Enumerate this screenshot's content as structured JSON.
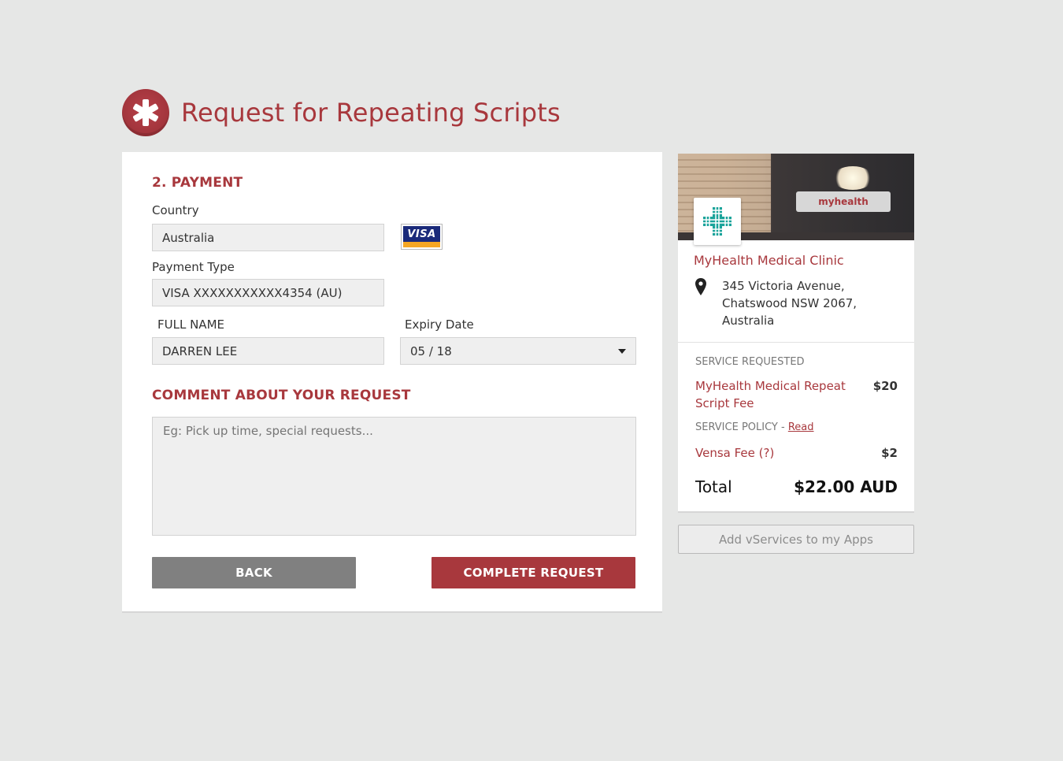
{
  "header": {
    "title": "Request for Repeating Scripts",
    "logo_icon": "asterisk-icon"
  },
  "payment": {
    "section_title": "2. PAYMENT",
    "country_label": "Country",
    "country_value": "Australia",
    "card_brand": "VISA",
    "payment_type_label": "Payment Type",
    "payment_type_value": "VISA XXXXXXXXXXX4354 (AU)",
    "full_name_label": "FULL NAME",
    "full_name_value": "DARREN LEE",
    "expiry_label": "Expiry Date",
    "expiry_value": "05 / 18"
  },
  "comment": {
    "section_title": "COMMENT ABOUT YOUR REQUEST",
    "placeholder": "Eg: Pick up time, special requests..."
  },
  "buttons": {
    "back": "BACK",
    "complete": "COMPLETE REQUEST",
    "add_vservices": "Add vServices to my Apps"
  },
  "clinic": {
    "name": "MyHealth Medical Clinic",
    "sign_text": "myhealth",
    "address_line1": "345 Victoria Avenue,",
    "address_line2": "Chatswood NSW 2067,",
    "address_line3": "Australia"
  },
  "summary": {
    "service_requested_label": "SERVICE REQUESTED",
    "service_name_line1": "MyHealth Medical Repeat",
    "service_name_line2": "Script Fee",
    "service_price": "$20",
    "policy_label": "SERVICE POLICY - ",
    "policy_link": "Read",
    "fee_name": "Vensa Fee (?)",
    "fee_price": "$2",
    "total_label": "Total",
    "total_value": "$22.00 AUD"
  },
  "colors": {
    "brand": "#a8383d",
    "back_button": "#808080",
    "background": "#e6e7e6",
    "clinic_logo": "#1aa39a"
  }
}
